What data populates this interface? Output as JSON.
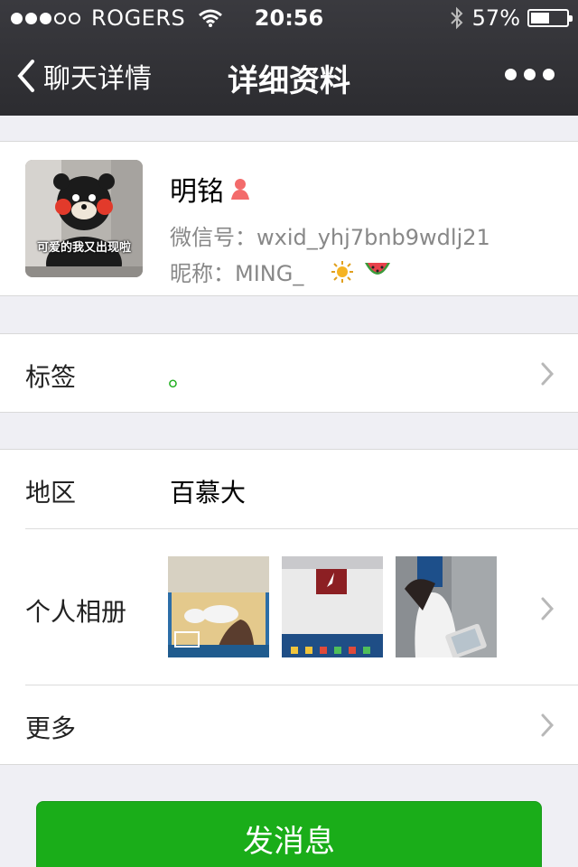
{
  "status_bar": {
    "carrier": "ROGERS",
    "time": "20:56",
    "battery": "57%",
    "battery_level": 0.57,
    "signal_bars_filled": 3,
    "signal_bars_total": 5
  },
  "nav": {
    "back_label": "聊天详情",
    "title": "详细资料"
  },
  "profile": {
    "name": "明铭",
    "wechat_id": "微信号：wxid_yhj7bnb9wdlj21",
    "nickname": "昵称：MING_",
    "avatar_caption": "可爱的我又出现啦"
  },
  "tags": {
    "label": "标签",
    "value": "。"
  },
  "info": {
    "region_label": "地区",
    "region_value": "百慕大",
    "album_label": "个人相册",
    "more_label": "更多"
  },
  "action": {
    "send_message": "发消息"
  },
  "colors": {
    "accent_green": "#1aad19",
    "header_bg": "#333337",
    "page_bg": "#efeff4"
  }
}
